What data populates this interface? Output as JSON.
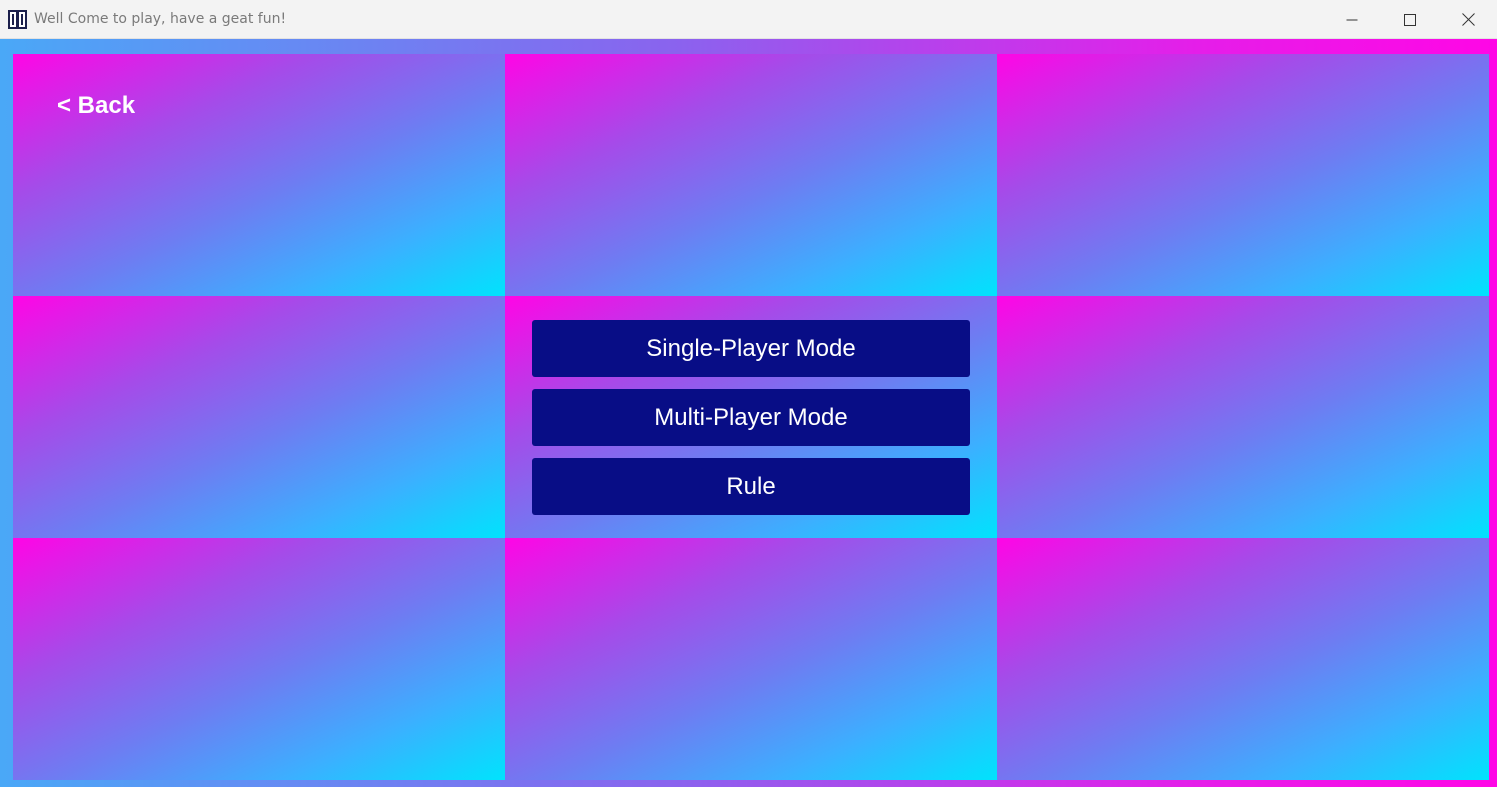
{
  "window": {
    "title": "Well Come to play, have a geat fun!",
    "app_icon": "app-logo-icon",
    "controls": {
      "minimize_icon": "minimize-icon",
      "maximize_icon": "maximize-icon",
      "close_icon": "close-icon"
    }
  },
  "nav": {
    "back_label": "< Back"
  },
  "menu": {
    "single_player_label": "Single-Player Mode",
    "multi_player_label": "Multi-Player Mode",
    "rule_label": "Rule"
  },
  "colors": {
    "titlebar_bg": "#f3f3f3",
    "button_bg": "#080d86",
    "gradient_pink": "#ff05e6",
    "gradient_cyan": "#00e3fd",
    "text_light": "#ffffff"
  }
}
